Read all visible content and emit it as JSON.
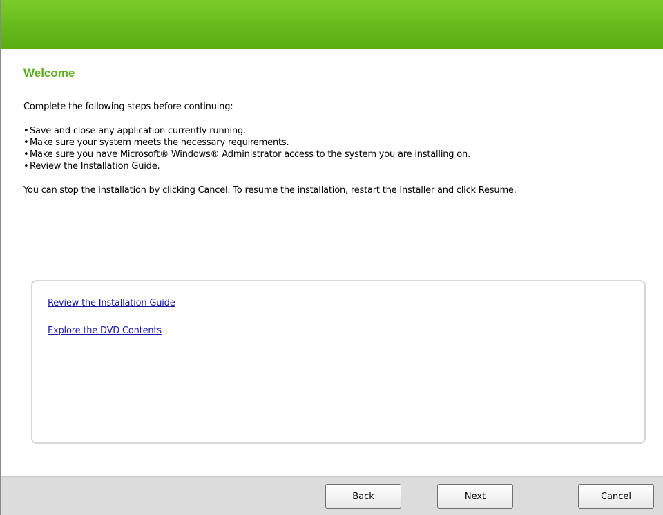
{
  "header": {
    "accent_color": "#68bd1c"
  },
  "page": {
    "title": "Welcome",
    "title_color": "#5aae18",
    "intro": "Complete the following steps before continuing:",
    "steps": [
      "Save and close any application currently running.",
      "Make sure your system meets the necessary requirements.",
      "Make sure you have Microsoft® Windows® Administrator access to the system you are installing on.",
      "Review the Installation Guide."
    ],
    "bullet": "•",
    "note": "You can stop the installation by clicking Cancel. To resume the installation, restart the Installer and click Resume."
  },
  "links": {
    "guide": "Review the Installation Guide",
    "dvd": "Explore the DVD Contents",
    "link_color": "#1a1aa6"
  },
  "footer": {
    "back_label": "Back",
    "next_label": "Next",
    "cancel_label": "Cancel"
  }
}
